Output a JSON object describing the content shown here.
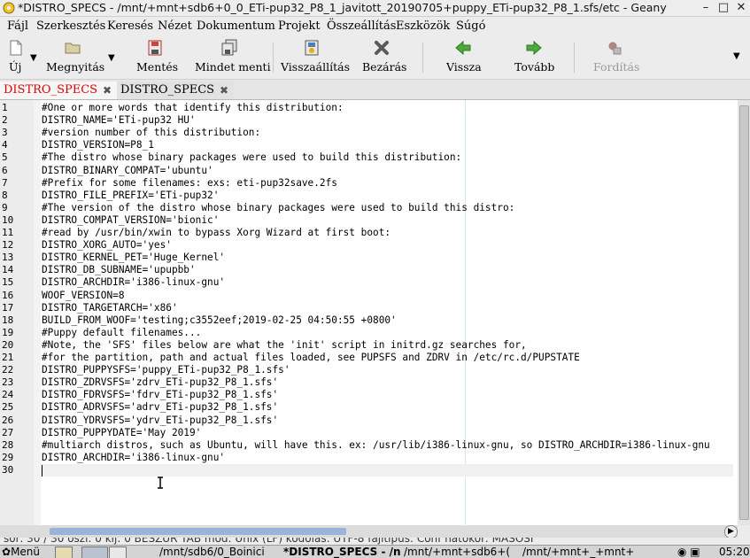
{
  "window": {
    "title": "*DISTRO_SPECS - /mnt/+mnt+sdb6+0_0_ETi-pup32_P8_1_javitott_20190705+puppy_ETi-pup32_P8_1.sfs/etc - Geany",
    "app_icon": "geany-icon",
    "minimize": "–",
    "maximize": "□",
    "close": "✕"
  },
  "menu": {
    "items": [
      "Fájl",
      "Szerkesztés",
      "Keresés",
      "Nézet",
      "Dokumentum",
      "Projekt",
      "Összeállítás",
      "Eszközök",
      "Súgó"
    ]
  },
  "toolbar": {
    "new_label": "Új",
    "open_label": "Megnyitás",
    "save_label": "Mentés",
    "save_all_label": "Mindet menti",
    "revert_label": "Visszaállítás",
    "close_label": "Bezárás",
    "back_label": "Vissza",
    "forward_label": "Tovább",
    "compile_label": "Fordítás",
    "dropdown": "▼",
    "overflow": "▼",
    "colors": {
      "back_arrow": "#4fa83a",
      "forward_arrow": "#4fa83a",
      "close_x": "#5a5a5a"
    }
  },
  "tabs": [
    {
      "label": "DISTRO_SPECS",
      "modified": true,
      "active": true,
      "close": "✖"
    },
    {
      "label": "DISTRO_SPECS",
      "modified": false,
      "active": false,
      "close": "✖"
    }
  ],
  "colors": {
    "modified_tab": "#e00000",
    "current_line": "#f0f0f0",
    "edge_line": "#d7ebe6"
  },
  "editor": {
    "lines": [
      "#One or more words that identify this distribution:",
      "DISTRO_NAME='ETi-pup32 HU'",
      "#version number of this distribution:",
      "DISTRO_VERSION=P8_1",
      "#The distro whose binary packages were used to build this distribution:",
      "DISTRO_BINARY_COMPAT='ubuntu'",
      "#Prefix for some filenames: exs: eti-pup32save.2fs",
      "DISTRO_FILE_PREFIX='ETi-pup32'",
      "#The version of the distro whose binary packages were used to build this distro:",
      "DISTRO_COMPAT_VERSION='bionic'",
      "#read by /usr/bin/xwin to bypass Xorg Wizard at first boot:",
      "DISTRO_XORG_AUTO='yes'",
      "DISTRO_KERNEL_PET='Huge_Kernel'",
      "DISTRO_DB_SUBNAME='upupbb'",
      "DISTRO_ARCHDIR='i386-linux-gnu'",
      "WOOF_VERSION=8",
      "DISTRO_TARGETARCH='x86'",
      "BUILD_FROM_WOOF='testing;c3552eef;2019-02-25 04:50:55 +0800'",
      "#Puppy default filenames...",
      "#Note, the 'SFS' files below are what the 'init' script in initrd.gz searches for,",
      "#for the partition, path and actual files loaded, see PUPSFS and ZDRV in /etc/rc.d/PUPSTATE",
      "DISTRO_PUPPYSFS='puppy_ETi-pup32_P8_1.sfs'",
      "DISTRO_ZDRVSFS='zdrv_ETi-pup32_P8_1.sfs'",
      "DISTRO_FDRVSFS='fdrv_ETi-pup32_P8_1.sfs'",
      "DISTRO_ADRVSFS='adrv_ETi-pup32_P8_1.sfs'",
      "DISTRO_YDRVSFS='ydrv_ETi-pup32_P8_1.sfs'",
      "DISTRO_PUPPYDATE='May 2019'",
      "#multiarch distros, such as Ubuntu, will have this. ex: /usr/lib/i386-linux-gnu, so DISTRO_ARCHDIR=i386-linux-gnu",
      "DISTRO_ARCHDIR='i386-linux-gnu'",
      ""
    ],
    "current_line": 30
  },
  "statusbar": {
    "text": "sor: 30 / 30   oszl: 0   kij: 0   BESZÚR   TAB   mód: Unix (LF)   kódolás: UTF-8   fájltípus: Conf   hatókör: MÁSOSÍ"
  },
  "taskbar": {
    "menu_label": "Menü",
    "items": [
      "/mnt/sdb6/0_Boinici",
      "*DISTRO_SPECS - /n",
      "/mnt/+mnt+sdb6+(",
      "/mnt/+mnt+_+mnt+"
    ],
    "clock": "05:20"
  }
}
